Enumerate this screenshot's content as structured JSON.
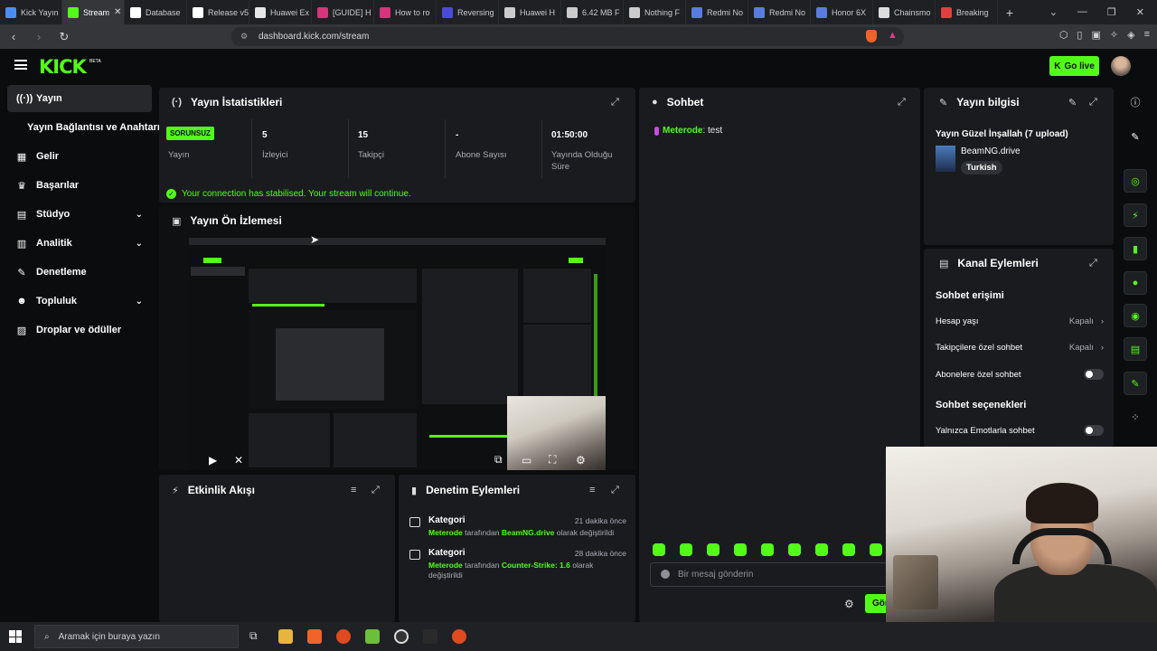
{
  "browser": {
    "tabs": [
      {
        "label": "Kick Yayın",
        "color": "#4a8ef5",
        "active": false
      },
      {
        "label": "Stream",
        "color": "#53fc18",
        "active": true
      },
      {
        "label": "Database",
        "color": "#ffffff",
        "active": false
      },
      {
        "label": "Release v5",
        "color": "#ffffff",
        "active": false
      },
      {
        "label": "Huawei Ex",
        "color": "#e5e5e5",
        "active": false
      },
      {
        "label": "[GUIDE] H",
        "color": "#d6347b",
        "active": false
      },
      {
        "label": "How to ro",
        "color": "#d6347b",
        "active": false
      },
      {
        "label": "Reversing",
        "color": "#4b4bd9",
        "active": false
      },
      {
        "label": "Huawei H",
        "color": "#cccccc",
        "active": false
      },
      {
        "label": "6.42 MB F",
        "color": "#cccccc",
        "active": false
      },
      {
        "label": "Nothing F",
        "color": "#cccccc",
        "active": false
      },
      {
        "label": "Redmi No",
        "color": "#5a7be0",
        "active": false
      },
      {
        "label": "Redmi No",
        "color": "#5a7be0",
        "active": false
      },
      {
        "label": "Honor 6X",
        "color": "#5a7be0",
        "active": false
      },
      {
        "label": "Chainsmo",
        "color": "#dddddd",
        "active": false
      },
      {
        "label": "Breaking",
        "color": "#e04040",
        "active": false
      }
    ],
    "url": "dashboard.kick.com/stream"
  },
  "header": {
    "logo": "KICK",
    "logo_badge": "BETA",
    "go_live": "Go live"
  },
  "sidebar": {
    "items": [
      {
        "label": "Yayın",
        "icon": "broadcast-icon"
      },
      {
        "label": "Yayın Bağlantısı ve Anahtarı",
        "icon": ""
      },
      {
        "label": "Gelir",
        "icon": "revenue-icon"
      },
      {
        "label": "Başarılar",
        "icon": "trophy-icon"
      },
      {
        "label": "Stüdyo",
        "icon": "studio-icon"
      },
      {
        "label": "Analitik",
        "icon": "analytics-icon"
      },
      {
        "label": "Denetleme",
        "icon": "wrench-icon"
      },
      {
        "label": "Topluluk",
        "icon": "community-icon"
      },
      {
        "label": "Droplar ve ödüller",
        "icon": "gift-icon"
      }
    ]
  },
  "stats": {
    "title": "Yayın İstatistikleri",
    "status_badge": "SORUNSUZ",
    "status_label": "Yayın",
    "viewers_value": "5",
    "viewers_label": "İzleyici",
    "followers_value": "15",
    "followers_label": "Takipçi",
    "subs_value": "-",
    "subs_label": "Abone Sayısı",
    "uptime_value": "01:50:00",
    "uptime_label": "Yayında Olduğu Süre",
    "connection_message": "Your connection has stabilised. Your stream will continue."
  },
  "preview": {
    "title": "Yayın Ön İzlemesi"
  },
  "activity": {
    "title": "Etkinlik Akışı"
  },
  "modlog": {
    "title": "Denetim Eylemleri",
    "entries": [
      {
        "head": "Kategori",
        "time": "21 dakika önce",
        "user": "Meterode",
        "pre": "tarafından",
        "value": "BeamNG.drive",
        "post": "olarak değiştirildi"
      },
      {
        "head": "Kategori",
        "time": "28 dakika önce",
        "user": "Meterode",
        "pre": "tarafından",
        "value": "Counter-Strike: 1.6",
        "post": "olarak değiştirildi"
      }
    ]
  },
  "chat": {
    "title": "Sohbet",
    "messages": [
      {
        "user": "Meterode",
        "text": ": test"
      }
    ],
    "input_placeholder": "Bir mesaj gönderin",
    "send_label": "Gönder"
  },
  "info": {
    "title": "Yayın bilgisi",
    "stream_title": "Yayın Güzel İnşallah (7 upload)",
    "game": "BeamNG.drive",
    "language": "Turkish"
  },
  "channel_actions": {
    "title": "Kanal Eylemleri",
    "section_access": "Sohbet erişimi",
    "account_age": "Hesap yaşı",
    "account_age_val": "Kapalı",
    "followers_only": "Takipçilere özel sohbet",
    "followers_only_val": "Kapalı",
    "subs_only": "Abonelere özel sohbet",
    "section_options": "Sohbet seçenekleri",
    "emote_only": "Yalnızca Emotlarla sohbet"
  },
  "taskbar": {
    "search_placeholder": "Aramak için buraya yazın"
  },
  "colors": {
    "accent": "#53fc18",
    "panel": "#191b1f",
    "background": "#0b0c0d"
  }
}
